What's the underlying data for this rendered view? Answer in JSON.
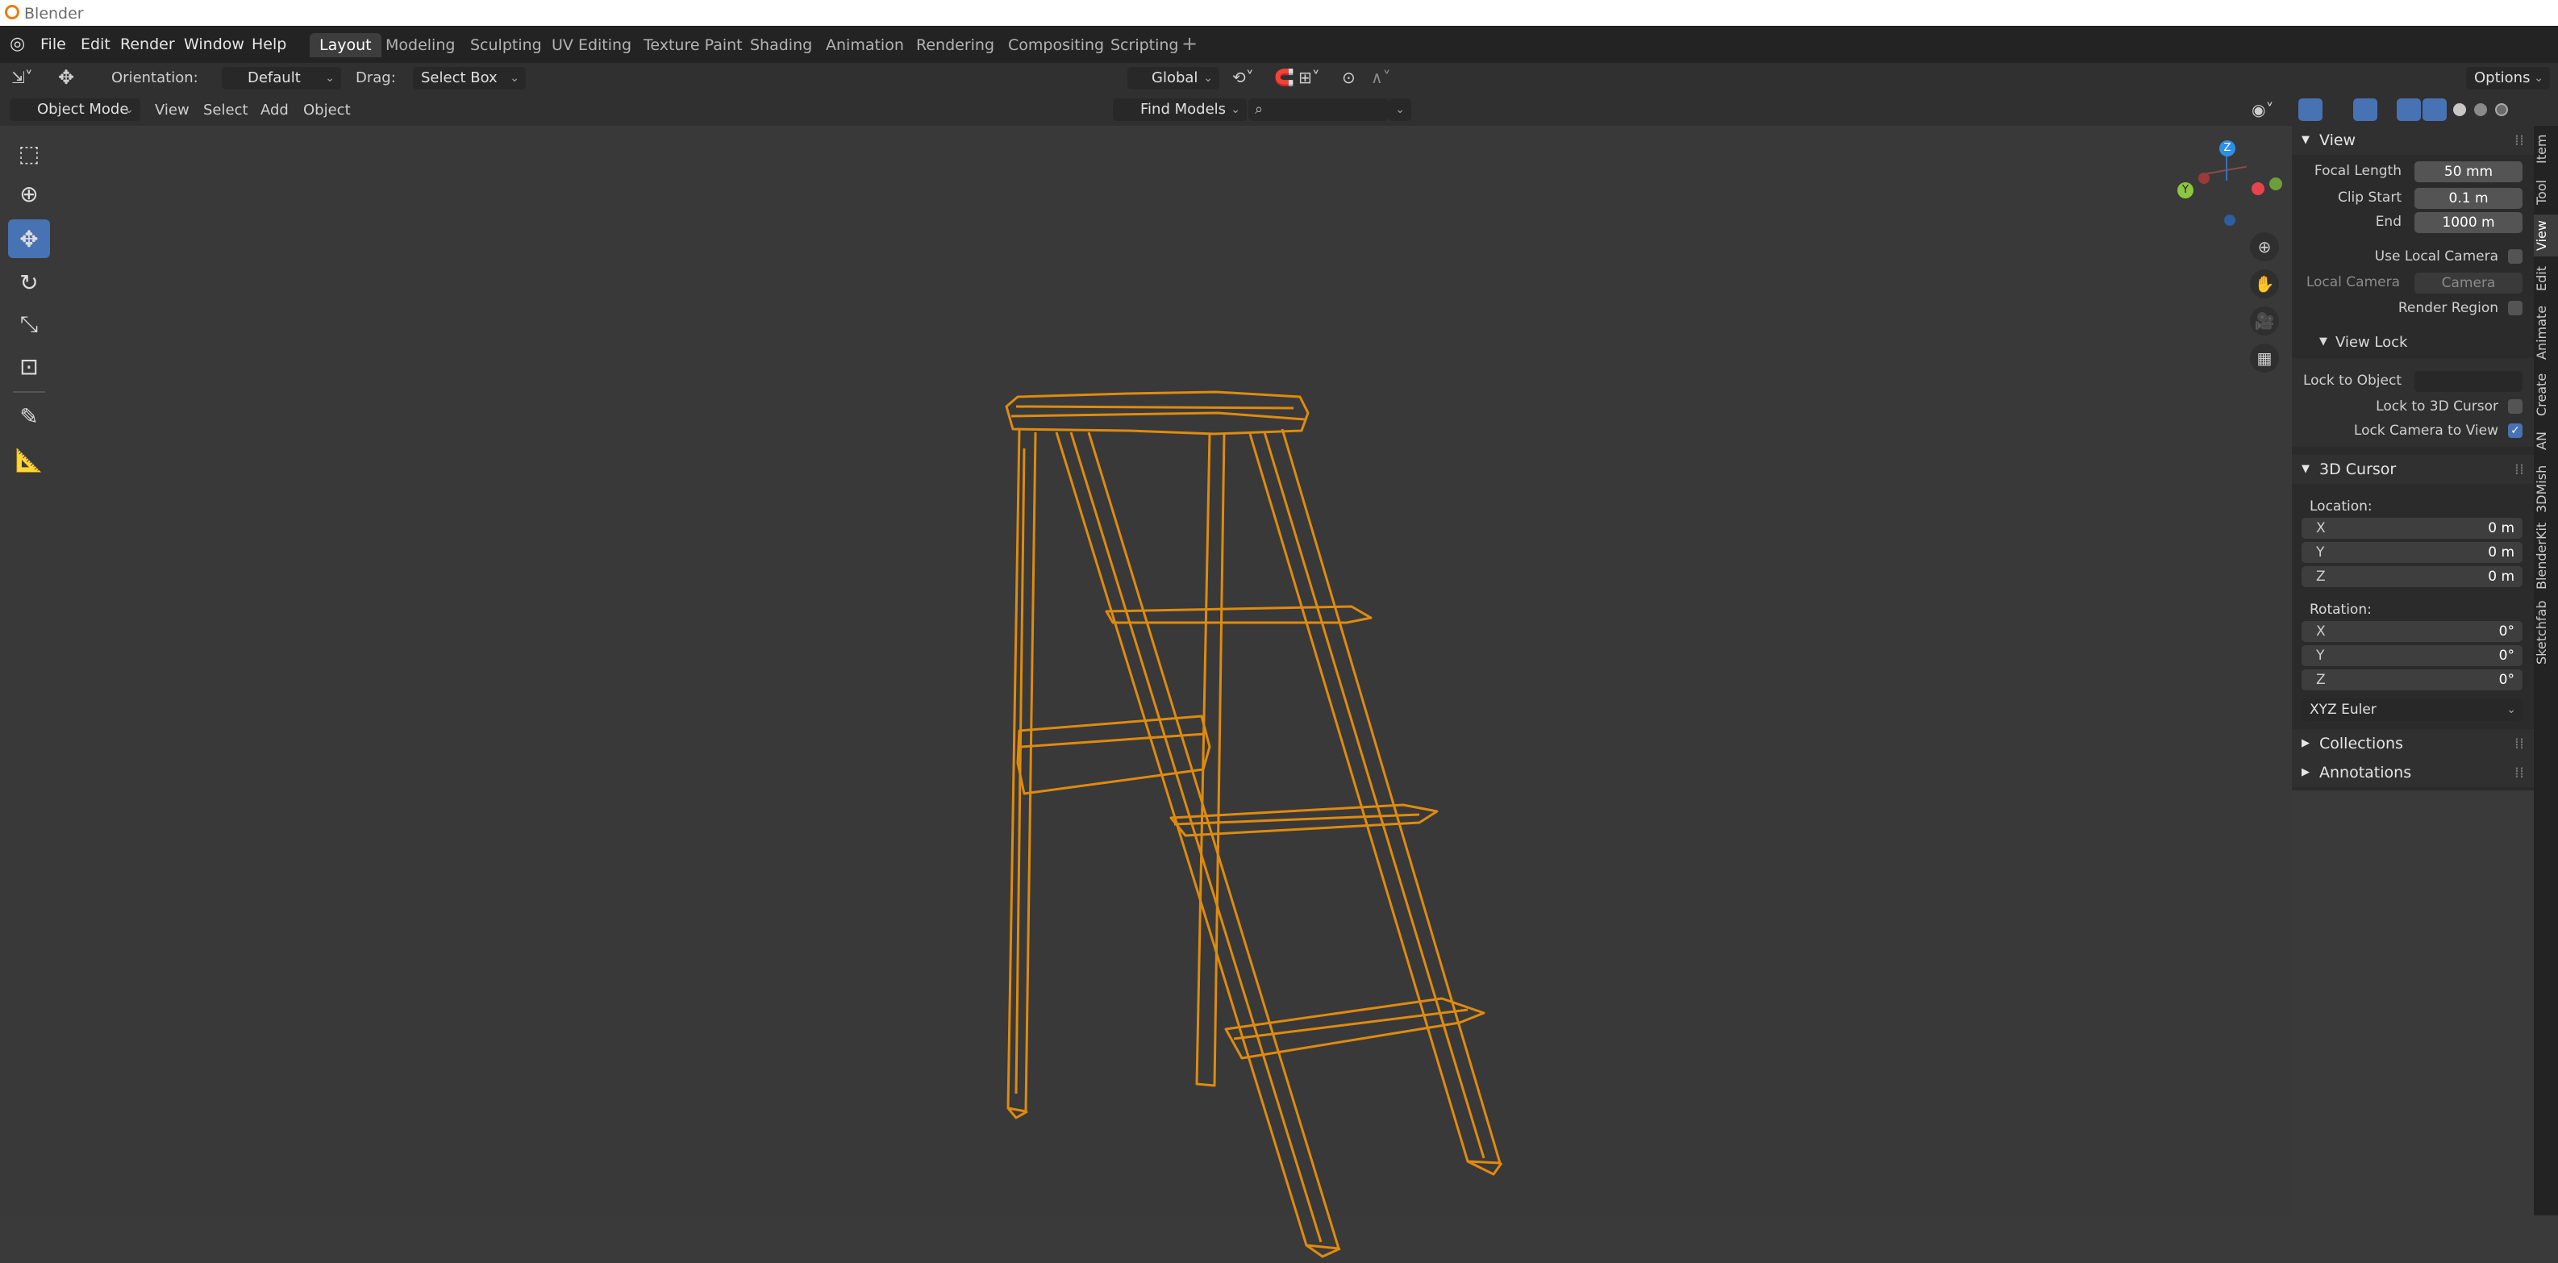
{
  "window": {
    "title": "Blender"
  },
  "menu": {
    "file": "File",
    "edit": "Edit",
    "render": "Render",
    "window": "Window",
    "help": "Help"
  },
  "workspaces": [
    "Layout",
    "Modeling",
    "Sculpting",
    "UV Editing",
    "Texture Paint",
    "Shading",
    "Animation",
    "Rendering",
    "Compositing",
    "Scripting"
  ],
  "add_workspace": "+",
  "toolheader": {
    "orientation_label": "Orientation:",
    "orientation_value": "Default",
    "drag_label": "Drag:",
    "drag_value": "Select Box",
    "transform_orientation": "Global",
    "options": "Options"
  },
  "header": {
    "mode": "Object Mode",
    "view": "View",
    "select": "Select",
    "add": "Add",
    "object": "Object",
    "find_models": "Find Models",
    "search_placeholder": ""
  },
  "gizmo": {
    "z": "Z",
    "y": "Y"
  },
  "sidebar": {
    "tabs": [
      "Item",
      "Tool",
      "View",
      "Edit",
      "Animate",
      "Create",
      "AN",
      "3DMish",
      "BlenderKit",
      "Sketchfab"
    ],
    "active_tab": "View",
    "view_panel": {
      "title": "View",
      "focal_length_label": "Focal Length",
      "focal_length": "50 mm",
      "clip_start_label": "Clip Start",
      "clip_start": "0.1 m",
      "end_label": "End",
      "end": "1000 m",
      "use_local_camera": "Use Local Camera",
      "local_camera_label": "Local Camera",
      "local_camera_value": "Camera",
      "render_region": "Render Region"
    },
    "view_lock": {
      "title": "View Lock",
      "lock_to_object": "Lock to Object",
      "lock_to_3d_cursor": "Lock to 3D Cursor",
      "lock_camera_to_view": "Lock Camera to View",
      "lock_camera_to_view_checked": true
    },
    "cursor_panel": {
      "title": "3D Cursor",
      "location_label": "Location:",
      "location": [
        {
          "axis": "X",
          "value": "0 m"
        },
        {
          "axis": "Y",
          "value": "0 m"
        },
        {
          "axis": "Z",
          "value": "0 m"
        }
      ],
      "rotation_label": "Rotation:",
      "rotation": [
        {
          "axis": "X",
          "value": "0°"
        },
        {
          "axis": "Y",
          "value": "0°"
        },
        {
          "axis": "Z",
          "value": "0°"
        }
      ],
      "rotation_mode": "XYZ Euler"
    },
    "collections": "Collections",
    "annotations": "Annotations"
  },
  "colors": {
    "accent": "#4772b3",
    "wireframe": "#e8900c",
    "viewport_bg": "#393939"
  }
}
